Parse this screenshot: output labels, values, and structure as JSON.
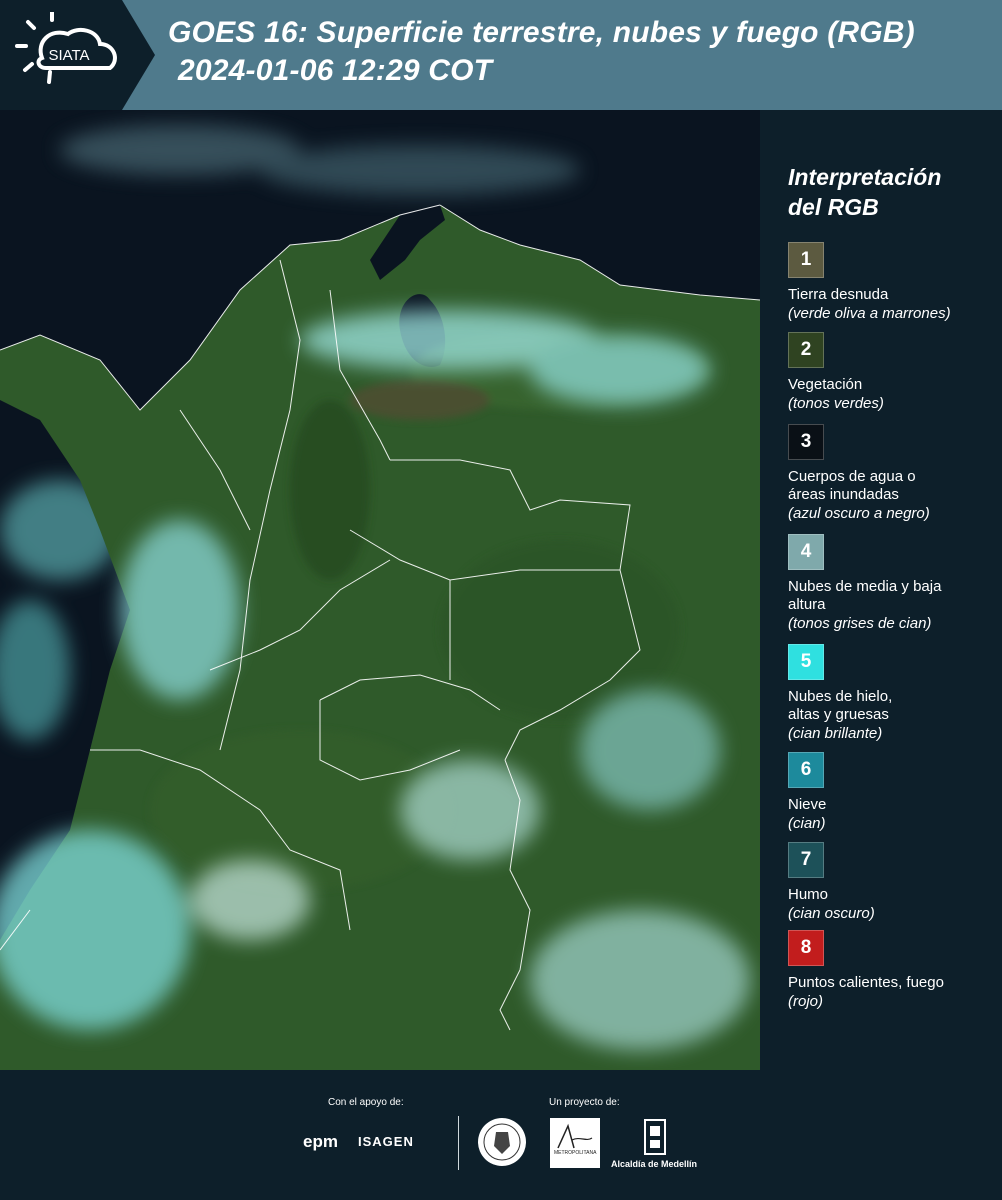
{
  "header": {
    "logo_text": "SIATA",
    "title_line1": "GOES 16: Superficie terrestre, nubes y fuego (RGB)",
    "title_line2": "2024-01-06 12:29 COT"
  },
  "legend": {
    "title_line1": "Interpretación",
    "title_line2": "del RGB",
    "items": [
      {
        "number": "1",
        "color": "#5c5a40",
        "label": "Tierra desnuda",
        "desc": "(verde oliva a marrones)"
      },
      {
        "number": "2",
        "color": "#2f4321",
        "label": "Vegetación",
        "desc": "(tonos verdes)"
      },
      {
        "number": "3",
        "color": "#0a1016",
        "label": "Cuerpos de agua o áreas inundadas",
        "desc": "(azul oscuro a negro)"
      },
      {
        "number": "4",
        "color": "#7fa9ab",
        "label": "Nubes de media y baja altura",
        "desc": "(tonos grises de cian)"
      },
      {
        "number": "5",
        "color": "#2fe0e0",
        "label": "Nubes de hielo, altas y gruesas",
        "desc": "(cian brillante)"
      },
      {
        "number": "6",
        "color": "#1d8a9c",
        "label": "Nieve",
        "desc": "(cian)"
      },
      {
        "number": "7",
        "color": "#1d5159",
        "label": "Humo",
        "desc": "(cian oscuro)"
      },
      {
        "number": "8",
        "color": "#c21d1d",
        "label": "Puntos calientes, fuego",
        "desc": "(rojo)"
      }
    ]
  },
  "footer": {
    "support_label": "Con el apoyo de:",
    "project_label": "Un proyecto de:",
    "sponsor1": "epm",
    "sponsor2": "ISAGEN",
    "area_text": "METROPOLITANA",
    "medellin_text": "Alcaldía de Medellín"
  }
}
